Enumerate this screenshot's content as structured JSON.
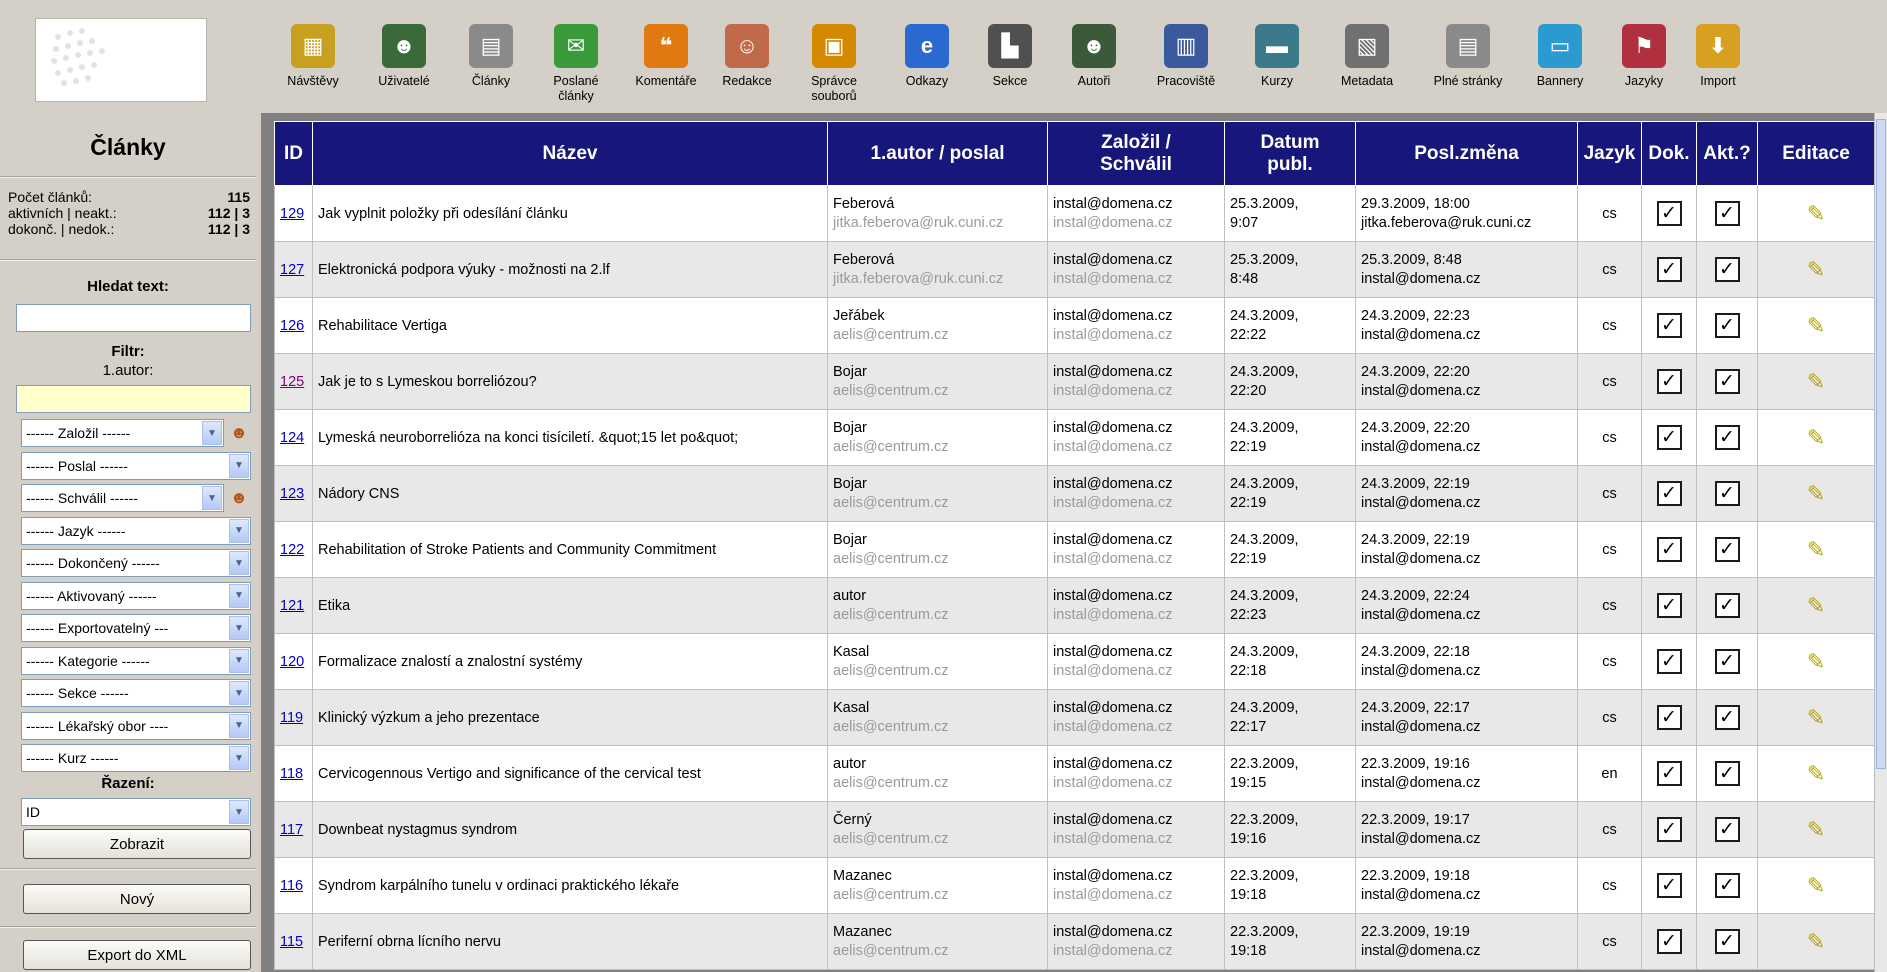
{
  "toolbar": [
    {
      "label": "Návštěvy",
      "icon": "chart-icon",
      "color": "#c8a020",
      "glyph": "▦"
    },
    {
      "label": "Uživatelé",
      "icon": "users-icon",
      "color": "#3a6a3a",
      "glyph": "☻"
    },
    {
      "label": "Články",
      "icon": "newspaper-icon",
      "color": "#8a8a8a",
      "glyph": "▤"
    },
    {
      "label": "Poslané\nčlánky",
      "icon": "sent-articles-icon",
      "color": "#3a9a3a",
      "glyph": "✉"
    },
    {
      "label": "Komentáře",
      "icon": "comment-icon",
      "color": "#e07a10",
      "glyph": "❝"
    },
    {
      "label": "Redakce",
      "icon": "editor-person-icon",
      "color": "#c06a4a",
      "glyph": "☺"
    },
    {
      "label": "Správce\nsouborů",
      "icon": "file-manager-icon",
      "color": "#d48a00",
      "glyph": "▣"
    },
    {
      "label": "Odkazy",
      "icon": "internet-explorer-icon",
      "color": "#2a6ad0",
      "glyph": "e"
    },
    {
      "label": "Sekce",
      "icon": "sections-icon",
      "color": "#505050",
      "glyph": "▙"
    },
    {
      "label": "Autoři",
      "icon": "authors-icon",
      "color": "#3a5a3a",
      "glyph": "☻"
    },
    {
      "label": "Pracoviště",
      "icon": "building-icon",
      "color": "#3a5aa0",
      "glyph": "▥"
    },
    {
      "label": "Kurzy",
      "icon": "courses-icon",
      "color": "#3a7a8a",
      "glyph": "▬"
    },
    {
      "label": "Metadata",
      "icon": "metadata-icon",
      "color": "#707070",
      "glyph": "▧"
    },
    {
      "label": "Plné stránky",
      "icon": "full-pages-icon",
      "color": "#8a8a8a",
      "glyph": "▤"
    },
    {
      "label": "Bannery",
      "icon": "banners-icon",
      "color": "#2a9ad0",
      "glyph": "▭"
    },
    {
      "label": "Jazyky",
      "icon": "languages-icon",
      "color": "#b03040",
      "glyph": "⚑"
    },
    {
      "label": "Import",
      "icon": "import-icon",
      "color": "#d8a020",
      "glyph": "⬇"
    }
  ],
  "sidebar": {
    "title": "Články",
    "stats": [
      {
        "label": "Počet článků:",
        "value": "115"
      },
      {
        "label": "aktivních | neakt.:",
        "value": "112 | 3"
      },
      {
        "label": "dokonč. | nedok.:",
        "value": "112 | 3"
      }
    ],
    "search_label": "Hledat text:",
    "search_value": "",
    "filter_label": "Filtr:",
    "author_label": "1.autor:",
    "author_value": "",
    "filters": [
      "------ Založil ------",
      "------ Poslal ------",
      "------ Schválil ------",
      "------ Jazyk ------",
      "------ Dokončený ------",
      "------ Aktivovaný ------",
      "------ Exportovatelný ---",
      "------ Kategorie ------",
      "------ Sekce ------",
      "------ Lékařský obor ----",
      "------ Kurz ------"
    ],
    "sort_label": "Řazení:",
    "sort_value": "ID",
    "show_button": "Zobrazit",
    "new_button": "Nový",
    "export_button": "Export do XML"
  },
  "table": {
    "headers": {
      "id": "ID",
      "name": "Název",
      "author": "1.autor / poslal",
      "founded": "Založil /\nSchválil",
      "published": "Datum\npubl.",
      "changed": "Posl.změna",
      "lang": "Jazyk",
      "done": "Dok.",
      "active": "Akt.?",
      "edit": "Editace"
    },
    "rows": [
      {
        "id": "129",
        "name": "Jak vyplnit položky při odesílání článku",
        "author": "Feberová",
        "sender": "jitka.feberova@ruk.cuni.cz",
        "founder": "instal@domena.cz",
        "approver": "instal@domena.cz",
        "pub_date": "25.3.2009,",
        "pub_time": "9:07",
        "changed": "29.3.2009, 18:00",
        "changed_by": "jitka.feberova@ruk.cuni.cz",
        "lang": "cs",
        "done": "✓",
        "active": "✓"
      },
      {
        "id": "127",
        "name": "Elektronická podpora výuky - možnosti na 2.lf",
        "author": "Feberová",
        "sender": "jitka.feberova@ruk.cuni.cz",
        "founder": "instal@domena.cz",
        "approver": "instal@domena.cz",
        "pub_date": "25.3.2009,",
        "pub_time": "8:48",
        "changed": "25.3.2009, 8:48",
        "changed_by": "instal@domena.cz",
        "lang": "cs",
        "done": "✓",
        "active": "✓"
      },
      {
        "id": "126",
        "name": "Rehabilitace Vertiga",
        "author": "Jeřábek",
        "sender": "aelis@centrum.cz",
        "founder": "instal@domena.cz",
        "approver": "instal@domena.cz",
        "pub_date": "24.3.2009,",
        "pub_time": "22:22",
        "changed": "24.3.2009, 22:23",
        "changed_by": "instal@domena.cz",
        "lang": "cs",
        "done": "✓",
        "active": "✓"
      },
      {
        "id": "125",
        "name": "Jak je to s Lymeskou borreliózou?",
        "author": "Bojar",
        "sender": "aelis@centrum.cz",
        "founder": "instal@domena.cz",
        "approver": "instal@domena.cz",
        "pub_date": "24.3.2009,",
        "pub_time": "22:20",
        "changed": "24.3.2009, 22:20",
        "changed_by": "instal@domena.cz",
        "lang": "cs",
        "done": "✓",
        "active": "✓",
        "visited": true
      },
      {
        "id": "124",
        "name": "Lymeská neuroborrelióza na konci tisíciletí. &quot;15 let po&quot;",
        "author": "Bojar",
        "sender": "aelis@centrum.cz",
        "founder": "instal@domena.cz",
        "approver": "instal@domena.cz",
        "pub_date": "24.3.2009,",
        "pub_time": "22:19",
        "changed": "24.3.2009, 22:20",
        "changed_by": "instal@domena.cz",
        "lang": "cs",
        "done": "✓",
        "active": "✓"
      },
      {
        "id": "123",
        "name": "Nádory CNS",
        "author": "Bojar",
        "sender": "aelis@centrum.cz",
        "founder": "instal@domena.cz",
        "approver": "instal@domena.cz",
        "pub_date": "24.3.2009,",
        "pub_time": "22:19",
        "changed": "24.3.2009, 22:19",
        "changed_by": "instal@domena.cz",
        "lang": "cs",
        "done": "✓",
        "active": "✓"
      },
      {
        "id": "122",
        "name": "Rehabilitation of Stroke Patients and Community Commitment",
        "author": "Bojar",
        "sender": "aelis@centrum.cz",
        "founder": "instal@domena.cz",
        "approver": "instal@domena.cz",
        "pub_date": "24.3.2009,",
        "pub_time": "22:19",
        "changed": "24.3.2009, 22:19",
        "changed_by": "instal@domena.cz",
        "lang": "cs",
        "done": "✓",
        "active": "✓"
      },
      {
        "id": "121",
        "name": "Etika",
        "author": "autor",
        "sender": "aelis@centrum.cz",
        "founder": "instal@domena.cz",
        "approver": "instal@domena.cz",
        "pub_date": "24.3.2009,",
        "pub_time": "22:23",
        "changed": "24.3.2009, 22:24",
        "changed_by": "instal@domena.cz",
        "lang": "cs",
        "done": "✓",
        "active": "✓"
      },
      {
        "id": "120",
        "name": "Formalizace znalostí a znalostní systémy",
        "author": "Kasal",
        "sender": "aelis@centrum.cz",
        "founder": "instal@domena.cz",
        "approver": "instal@domena.cz",
        "pub_date": "24.3.2009,",
        "pub_time": "22:18",
        "changed": "24.3.2009, 22:18",
        "changed_by": "instal@domena.cz",
        "lang": "cs",
        "done": "✓",
        "active": "✓"
      },
      {
        "id": "119",
        "name": "Klinický výzkum a jeho prezentace",
        "author": "Kasal",
        "sender": "aelis@centrum.cz",
        "founder": "instal@domena.cz",
        "approver": "instal@domena.cz",
        "pub_date": "24.3.2009,",
        "pub_time": "22:17",
        "changed": "24.3.2009, 22:17",
        "changed_by": "instal@domena.cz",
        "lang": "cs",
        "done": "✓",
        "active": "✓"
      },
      {
        "id": "118",
        "name": "Cervicogennous Vertigo and significance of the cervical test",
        "author": "autor",
        "sender": "aelis@centrum.cz",
        "founder": "instal@domena.cz",
        "approver": "instal@domena.cz",
        "pub_date": "22.3.2009,",
        "pub_time": "19:15",
        "changed": "22.3.2009, 19:16",
        "changed_by": "instal@domena.cz",
        "lang": "en",
        "done": "✓",
        "active": "✓"
      },
      {
        "id": "117",
        "name": "Downbeat nystagmus syndrom",
        "author": "Černý",
        "sender": "aelis@centrum.cz",
        "founder": "instal@domena.cz",
        "approver": "instal@domena.cz",
        "pub_date": "22.3.2009,",
        "pub_time": "19:16",
        "changed": "22.3.2009, 19:17",
        "changed_by": "instal@domena.cz",
        "lang": "cs",
        "done": "✓",
        "active": "✓"
      },
      {
        "id": "116",
        "name": "Syndrom karpálního tunelu v ordinaci praktického lékaře",
        "author": "Mazanec",
        "sender": "aelis@centrum.cz",
        "founder": "instal@domena.cz",
        "approver": "instal@domena.cz",
        "pub_date": "22.3.2009,",
        "pub_time": "19:18",
        "changed": "22.3.2009, 19:18",
        "changed_by": "instal@domena.cz",
        "lang": "cs",
        "done": "✓",
        "active": "✓"
      },
      {
        "id": "115",
        "name": "Periferní obrna lícního nervu",
        "author": "Mazanec",
        "sender": "aelis@centrum.cz",
        "founder": "instal@domena.cz",
        "approver": "instal@domena.cz",
        "pub_date": "22.3.2009,",
        "pub_time": "19:18",
        "changed": "22.3.2009, 19:19",
        "changed_by": "instal@domena.cz",
        "lang": "cs",
        "done": "✓",
        "active": "✓"
      }
    ]
  },
  "edit_icon": "pencil-edit-icon",
  "colors": {
    "header_bg": "#17177b",
    "row_alt": "#e8e8e8",
    "link": "#0000cc",
    "visited_link": "#800080"
  }
}
